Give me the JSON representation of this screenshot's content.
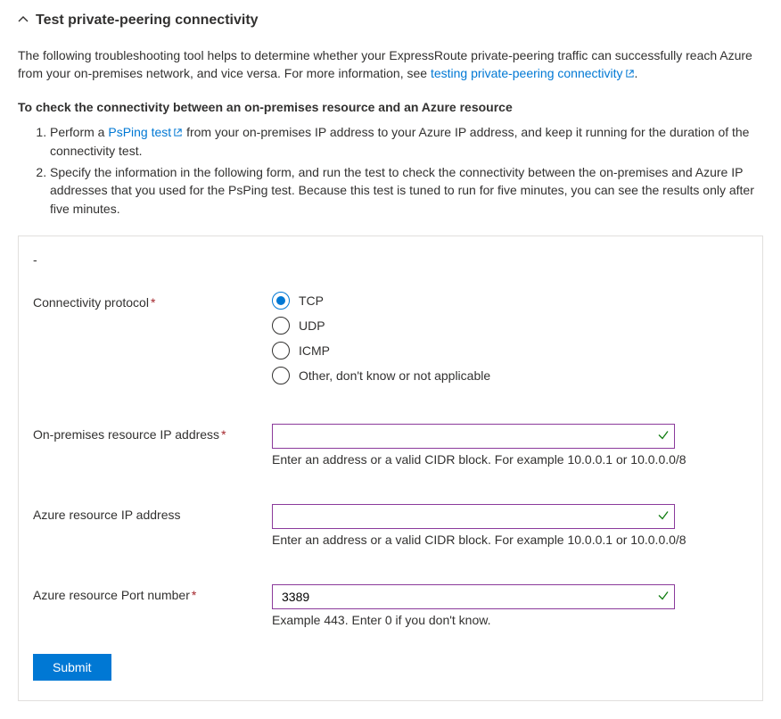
{
  "header": {
    "title": "Test private-peering connectivity"
  },
  "intro": {
    "text_before_link": "The following troubleshooting tool helps to determine whether your ExpressRoute private-peering traffic can successfully reach Azure from your on-premises network, and vice versa. For more information, see ",
    "link_text": "testing private-peering connectivity",
    "text_after_link": "."
  },
  "subhead": "To check the connectivity between an on-premises resource and an Azure resource",
  "steps": {
    "s1_before": "Perform a ",
    "s1_link": "PsPing test",
    "s1_after": " from your on-premises IP address to your Azure IP address, and keep it running for the duration of the connectivity test.",
    "s2": "Specify the information in the following form, and run the test to check the connectivity between the on-premises and Azure IP addresses that you used for the PsPing test. Because this test is tuned to run for five minutes, you can see the results only after five minutes."
  },
  "form": {
    "dash": "-",
    "protocol": {
      "label": "Connectivity protocol",
      "options": {
        "tcp": "TCP",
        "udp": "UDP",
        "icmp": "ICMP",
        "other": "Other, don't know or not applicable"
      }
    },
    "onprem_ip": {
      "label": "On-premises resource IP address",
      "value": "",
      "helper": "Enter an address or a valid CIDR block. For example 10.0.0.1 or 10.0.0.0/8"
    },
    "azure_ip": {
      "label": "Azure resource IP address",
      "value": "",
      "helper": "Enter an address or a valid CIDR block. For example 10.0.0.1 or 10.0.0.0/8"
    },
    "azure_port": {
      "label": "Azure resource Port number",
      "value": "3389",
      "helper": "Example 443. Enter 0 if you don't know."
    },
    "submit_label": "Submit"
  }
}
